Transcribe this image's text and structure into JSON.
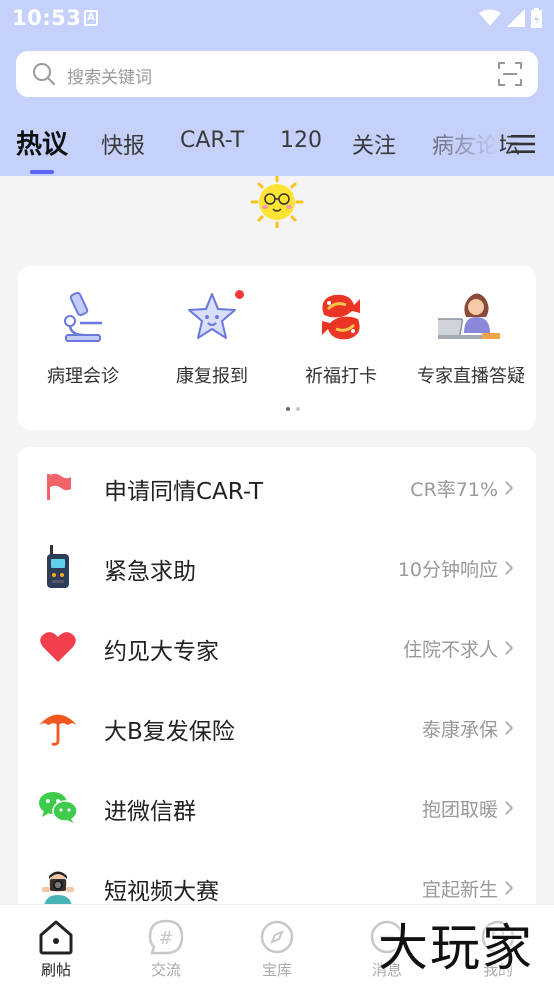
{
  "status": {
    "time": "10:53",
    "indicator": "A"
  },
  "search": {
    "placeholder": "搜索关键词"
  },
  "tabs": [
    {
      "label": "热议",
      "active": true
    },
    {
      "label": "快报"
    },
    {
      "label": "CAR-T"
    },
    {
      "label": "120"
    },
    {
      "label": "关注"
    },
    {
      "label": "病友论坛"
    }
  ],
  "shortcuts": [
    {
      "label": "病理会诊",
      "icon": "microscope-icon"
    },
    {
      "label": "康复报到",
      "icon": "star-face-icon",
      "badge": true
    },
    {
      "label": "祈福打卡",
      "icon": "koi-fish-icon"
    },
    {
      "label": "专家直播答疑",
      "icon": "expert-laptop-icon"
    }
  ],
  "services": [
    {
      "title": "申请同情CAR-T",
      "subtitle": "CR率71%",
      "icon": "flag-icon"
    },
    {
      "title": "紧急求助",
      "subtitle": "10分钟响应",
      "icon": "walkie-talkie-icon"
    },
    {
      "title": "约见大专家",
      "subtitle": "住院不求人",
      "icon": "heart-icon"
    },
    {
      "title": "大B复发保险",
      "subtitle": "泰康承保",
      "icon": "umbrella-icon"
    },
    {
      "title": "进微信群",
      "subtitle": "抱团取暖",
      "icon": "wechat-icon"
    },
    {
      "title": "短视频大赛",
      "subtitle": "宜起新生",
      "icon": "camera-man-icon"
    }
  ],
  "nav": [
    {
      "label": "刷帖",
      "active": true
    },
    {
      "label": "交流"
    },
    {
      "label": "宝库"
    },
    {
      "label": "消息"
    },
    {
      "label": "我的"
    }
  ],
  "watermark": "大玩家",
  "colors": {
    "header": "#c5d0fb",
    "accent": "#5b66f0",
    "badge": "#f23a3a"
  }
}
